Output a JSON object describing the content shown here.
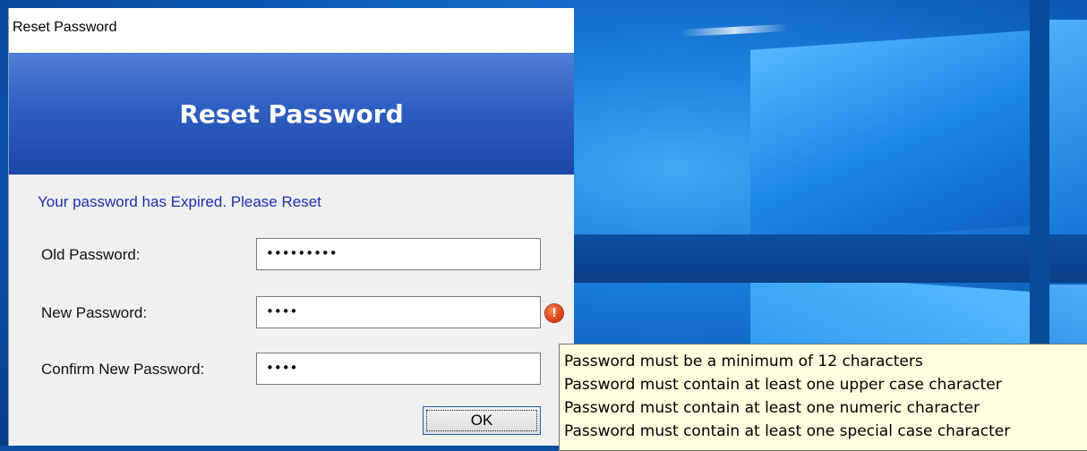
{
  "window": {
    "title": "Reset Password"
  },
  "banner": {
    "heading": "Reset Password"
  },
  "message": "Your password has Expired. Please Reset",
  "form": {
    "old_password": {
      "label": "Old Password:",
      "value": "•••••••••"
    },
    "new_password": {
      "label": "New Password:",
      "value": "••••"
    },
    "confirm_password": {
      "label": "Confirm New Password:",
      "value": "••••"
    }
  },
  "buttons": {
    "ok": "OK"
  },
  "error_icon_glyph": "!",
  "tooltip": {
    "lines": [
      "Password must be a minimum of 12 characters",
      "Password must contain at least one upper case character",
      "Password must contain at least one numeric character",
      "Password must contain at least one special case character"
    ]
  },
  "colors": {
    "banner": "#2f5fc2",
    "message": "#1a2fb0",
    "error_icon": "#e0441b",
    "tooltip_bg": "#ffffe1"
  },
  "icons": [
    "error-icon"
  ]
}
